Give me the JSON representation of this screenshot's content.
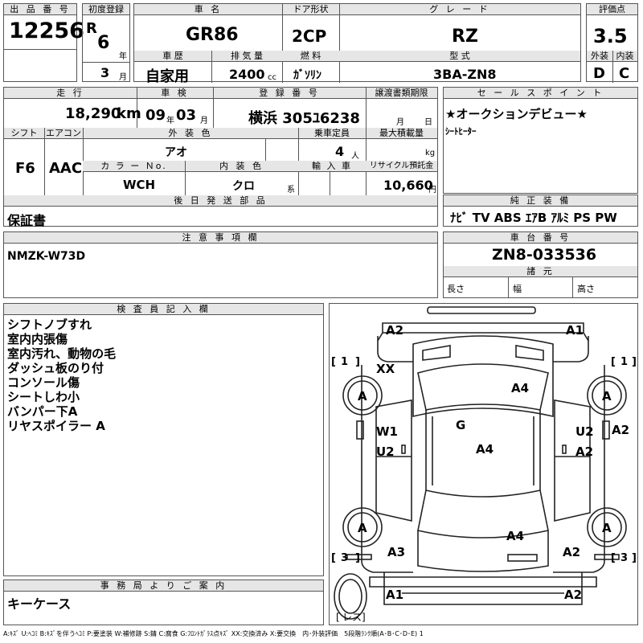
{
  "top": {
    "lot_label": "出 品 番 号",
    "lot_no": "12256",
    "first_reg_label": "初度登録",
    "era": "R",
    "year": "6",
    "year_unit": "年",
    "month": "3",
    "month_unit": "月",
    "car_name_label": "車 名",
    "car_name": "GR86",
    "door_label": "ドア形状",
    "door": "2CP",
    "grade_label": "グ レ ー ド",
    "grade": "RZ",
    "score_label": "評価点",
    "score": "3.5",
    "history_label": "車 歴",
    "history": "自家用",
    "displacement_label": "排 気 量",
    "displacement": "2400",
    "displacement_unit": "cc",
    "fuel_label": "燃 料",
    "fuel": "ｶﾞｿﾘﾝ",
    "model_label": "型 式",
    "model": "3BA-ZN8",
    "exterior_label": "外装",
    "exterior": "D",
    "interior_label": "内装",
    "interior": "C"
  },
  "mid": {
    "mileage_label": "走 行",
    "mileage": "18,290",
    "mileage_unit": "km",
    "inspection_label": "車 検",
    "insp_year": "09",
    "insp_year_unit": "年",
    "insp_month": "03",
    "insp_month_unit": "月",
    "reg_label": "登 録 番 号",
    "reg": "横浜 305ﾕ6238",
    "transfer_label": "譲渡書類期限",
    "transfer_month_unit": "月",
    "transfer_day_unit": "日",
    "shift_label": "シフト",
    "shift": "F6",
    "ac_label": "エアコン",
    "ac": "AAC",
    "ext_color_label": "外 装 色",
    "ext_color": "アオ",
    "capacity_label": "乗車定員",
    "capacity": "4",
    "capacity_unit": "人",
    "max_load_label": "最大積載量",
    "max_load_unit": "kg",
    "color_no_label": "カ ラ ー Ｎo.",
    "color_no": "WCH",
    "int_color_label": "内 装 色",
    "int_color": "クロ",
    "int_color_unit": "系",
    "import_label": "輸 入 車",
    "recycle_label": "リサイクル預託金",
    "recycle": "10,660",
    "recycle_unit": "円",
    "later_label": "後 日 発 送 部 品",
    "later": "保証書"
  },
  "sales": {
    "label": "セ ー ル ス ポ イ ン ト",
    "line1": "★オークションデビュー★",
    "line2": "ｼｰﾄﾋｰﾀｰ"
  },
  "equipment": {
    "label": "純 正 装 備",
    "items": "ﾅﾋﾞ TV ABS ｴｱB ｱﾙﾐ PS PW"
  },
  "notes": {
    "label": "注 意 事 項 欄",
    "text": "NMZK-W73D"
  },
  "chassis": {
    "label": "車 台 番 号",
    "value": "ZN8-033536",
    "dims_label": "諸 元",
    "length_label": "長さ",
    "width_label": "幅",
    "height_label": "高さ"
  },
  "inspector": {
    "label": "検 査 員 記 入 欄",
    "lines": [
      "シフトノブすれ",
      "室内内張傷",
      "室内汚れ、動物の毛",
      "ダッシュ板のり付",
      "コンソール傷",
      "シートしわ小",
      "バンパー下A",
      "リヤスポイラー A"
    ]
  },
  "office": {
    "label": "事 務 局 よ り ご 案 内",
    "text": "キーケース"
  },
  "diagram": {
    "marks": {
      "front_left": "A2",
      "front_right": "A1",
      "windshield_left": "XX",
      "hood": "A4",
      "roof": "G",
      "cabin": "A4",
      "door_left_1": "W1",
      "door_left_2": "U2",
      "door_right_1": "U2",
      "door_right_2": "A2",
      "fender_right": "A2",
      "trunk": "A4",
      "rear_left": "A3",
      "rear_right": "A2",
      "bumper_left": "A1",
      "bumper_right": "A2",
      "tire_fl": "A",
      "tire_fr": "A",
      "tire_rl": "A",
      "tire_rr": "A",
      "num_1_left": "1",
      "num_1_right": "1",
      "num_3_left": "3",
      "num_3_right": "3",
      "spare_label": "レス"
    }
  },
  "legend": "A:ｷｽﾞ U:ﾍｺﾐ B:ｷｽﾞを伴うﾍｺﾐ P:要塗装 W:補修跡 S:錆 C:腐食 G:ﾌﾛﾝﾄｶﾞﾗｽ点ｷｽﾞ XX:交換済み X:要交換　内･外装評価　5段階ﾗﾝｸ順(A･B･C･D･E) 1"
}
